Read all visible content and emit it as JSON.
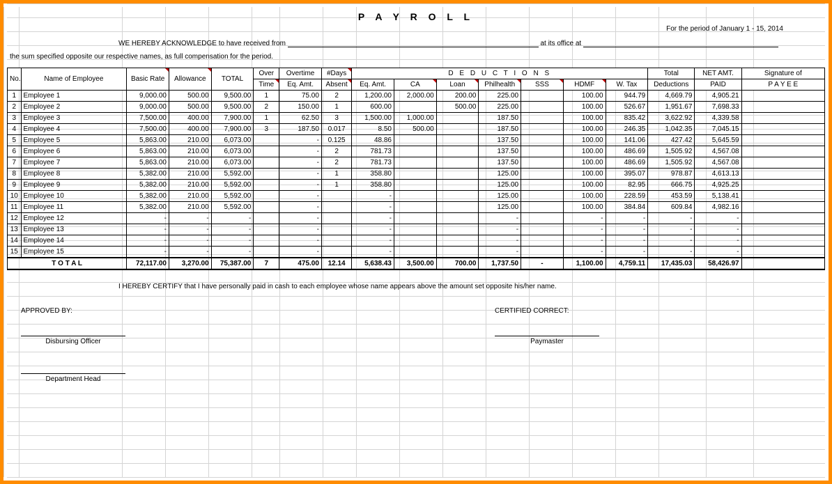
{
  "title": "P  A  Y  R  O  L  L",
  "period_label": "For the period of",
  "period_value": "January 1 - 15,  2014",
  "ack_prefix": "WE HEREBY ACKNOWLEDGE to have received from",
  "ack_mid": "at its office at",
  "sum_line": "the sum specified opposite our respective names, as full compensation for the period.",
  "headers": {
    "no": "No.",
    "name": "Name of Employee",
    "basic": "Basic Rate",
    "allowance": "Allowance",
    "total": "TOTAL",
    "over": "Over",
    "time": "Time",
    "overtime": "Overtime",
    "eqamt": "Eq. Amt.",
    "days": "#Days",
    "absent": "Absent",
    "deductions": "D  E  D  U  C  T  I  O  N  S",
    "ded_eq": "Eq. Amt.",
    "ca": "CA",
    "loan": "Loan",
    "philhealth": "Philhealth",
    "sss": "SSS",
    "hdmf": "HDMF",
    "wtax": "W. Tax",
    "totalded": "Total",
    "deductions2": "Deductions",
    "netamt": "NET AMT.",
    "paid": "PAID",
    "sigof": "Signature of",
    "payee": "P A Y E E"
  },
  "rows": [
    {
      "no": "1",
      "name": "Employee 1",
      "basic": "9,000.00",
      "allw": "500.00",
      "tot": "9,500.00",
      "ot": "1",
      "otamt": "75.00",
      "days": "2",
      "eq": "1,200.00",
      "ca": "2,000.00",
      "loan": "200.00",
      "phil": "225.00",
      "sss": "",
      "hdmf": "100.00",
      "wtax": "944.79",
      "tded": "4,669.79",
      "net": "4,905.21"
    },
    {
      "no": "2",
      "name": "Employee 2",
      "basic": "9,000.00",
      "allw": "500.00",
      "tot": "9,500.00",
      "ot": "2",
      "otamt": "150.00",
      "days": "1",
      "eq": "600.00",
      "ca": "",
      "loan": "500.00",
      "phil": "225.00",
      "sss": "",
      "hdmf": "100.00",
      "wtax": "526.67",
      "tded": "1,951.67",
      "net": "7,698.33"
    },
    {
      "no": "3",
      "name": "Employee 3",
      "basic": "7,500.00",
      "allw": "400.00",
      "tot": "7,900.00",
      "ot": "1",
      "otamt": "62.50",
      "days": "3",
      "eq": "1,500.00",
      "ca": "1,000.00",
      "loan": "",
      "phil": "187.50",
      "sss": "",
      "hdmf": "100.00",
      "wtax": "835.42",
      "tded": "3,622.92",
      "net": "4,339.58"
    },
    {
      "no": "4",
      "name": "Employee 4",
      "basic": "7,500.00",
      "allw": "400.00",
      "tot": "7,900.00",
      "ot": "3",
      "otamt": "187.50",
      "days": "0.017",
      "eq": "8.50",
      "ca": "500.00",
      "loan": "",
      "phil": "187.50",
      "sss": "",
      "hdmf": "100.00",
      "wtax": "246.35",
      "tded": "1,042.35",
      "net": "7,045.15"
    },
    {
      "no": "5",
      "name": "Employee 5",
      "basic": "5,863.00",
      "allw": "210.00",
      "tot": "6,073.00",
      "ot": "",
      "otamt": "-",
      "days": "0.125",
      "eq": "48.86",
      "ca": "",
      "loan": "",
      "phil": "137.50",
      "sss": "",
      "hdmf": "100.00",
      "wtax": "141.06",
      "tded": "427.42",
      "net": "5,645.59"
    },
    {
      "no": "6",
      "name": "Employee 6",
      "basic": "5,863.00",
      "allw": "210.00",
      "tot": "6,073.00",
      "ot": "",
      "otamt": "-",
      "days": "2",
      "eq": "781.73",
      "ca": "",
      "loan": "",
      "phil": "137.50",
      "sss": "",
      "hdmf": "100.00",
      "wtax": "486.69",
      "tded": "1,505.92",
      "net": "4,567.08"
    },
    {
      "no": "7",
      "name": "Employee 7",
      "basic": "5,863.00",
      "allw": "210.00",
      "tot": "6,073.00",
      "ot": "",
      "otamt": "-",
      "days": "2",
      "eq": "781.73",
      "ca": "",
      "loan": "",
      "phil": "137.50",
      "sss": "",
      "hdmf": "100.00",
      "wtax": "486.69",
      "tded": "1,505.92",
      "net": "4,567.08"
    },
    {
      "no": "8",
      "name": "Employee 8",
      "basic": "5,382.00",
      "allw": "210.00",
      "tot": "5,592.00",
      "ot": "",
      "otamt": "-",
      "days": "1",
      "eq": "358.80",
      "ca": "",
      "loan": "",
      "phil": "125.00",
      "sss": "",
      "hdmf": "100.00",
      "wtax": "395.07",
      "tded": "978.87",
      "net": "4,613.13"
    },
    {
      "no": "9",
      "name": "Employee 9",
      "basic": "5,382.00",
      "allw": "210.00",
      "tot": "5,592.00",
      "ot": "",
      "otamt": "-",
      "days": "1",
      "eq": "358.80",
      "ca": "",
      "loan": "",
      "phil": "125.00",
      "sss": "",
      "hdmf": "100.00",
      "wtax": "82.95",
      "tded": "666.75",
      "net": "4,925.25"
    },
    {
      "no": "10",
      "name": "Employee 10",
      "basic": "5,382.00",
      "allw": "210.00",
      "tot": "5,592.00",
      "ot": "",
      "otamt": "-",
      "days": "",
      "eq": "-",
      "ca": "",
      "loan": "",
      "phil": "125.00",
      "sss": "",
      "hdmf": "100.00",
      "wtax": "228.59",
      "tded": "453.59",
      "net": "5,138.41"
    },
    {
      "no": "11",
      "name": "Employee 11",
      "basic": "5,382.00",
      "allw": "210.00",
      "tot": "5,592.00",
      "ot": "",
      "otamt": "-",
      "days": "",
      "eq": "-",
      "ca": "",
      "loan": "",
      "phil": "125.00",
      "sss": "",
      "hdmf": "100.00",
      "wtax": "384.84",
      "tded": "609.84",
      "net": "4,982.16"
    },
    {
      "no": "12",
      "name": "Employee 12",
      "basic": "-",
      "allw": "-",
      "tot": "-",
      "ot": "",
      "otamt": "-",
      "days": "",
      "eq": "-",
      "ca": "",
      "loan": "",
      "phil": "-",
      "sss": "",
      "hdmf": "-",
      "wtax": "-",
      "tded": "-",
      "net": "-"
    },
    {
      "no": "13",
      "name": "Employee 13",
      "basic": "-",
      "allw": "-",
      "tot": "-",
      "ot": "",
      "otamt": "-",
      "days": "",
      "eq": "-",
      "ca": "",
      "loan": "",
      "phil": "-",
      "sss": "",
      "hdmf": "-",
      "wtax": "-",
      "tded": "-",
      "net": "-"
    },
    {
      "no": "14",
      "name": "Employee 14",
      "basic": "-",
      "allw": "-",
      "tot": "-",
      "ot": "",
      "otamt": "-",
      "days": "",
      "eq": "-",
      "ca": "",
      "loan": "",
      "phil": "-",
      "sss": "",
      "hdmf": "-",
      "wtax": "-",
      "tded": "-",
      "net": "-"
    },
    {
      "no": "15",
      "name": "Employee 15",
      "basic": "-",
      "allw": "-",
      "tot": "-",
      "ot": "",
      "otamt": "-",
      "days": "",
      "eq": "-",
      "ca": "",
      "loan": "",
      "phil": "-",
      "sss": "",
      "hdmf": "-",
      "wtax": "-",
      "tded": "-",
      "net": "-"
    }
  ],
  "totals": {
    "label": "T O T A L",
    "basic": "72,117.00",
    "allw": "3,270.00",
    "tot": "75,387.00",
    "ot": "7",
    "otamt": "475.00",
    "days": "12.14",
    "eq": "5,638.43",
    "ca": "3,500.00",
    "loan": "700.00",
    "phil": "1,737.50",
    "sss": "-",
    "hdmf": "1,100.00",
    "wtax": "4,759.11",
    "tded": "17,435.03",
    "net": "58,426.97"
  },
  "certify": "I HEREBY CERTIFY  that I have personally paid in cash to each employee whose name appears above the amount set opposite his/her name.",
  "approved_by": "APPROVED BY:",
  "certified_correct": "CERTIFIED CORRECT:",
  "disbursing": "Disbursing Officer",
  "paymaster": "Paymaster",
  "dept_head": "Department Head"
}
